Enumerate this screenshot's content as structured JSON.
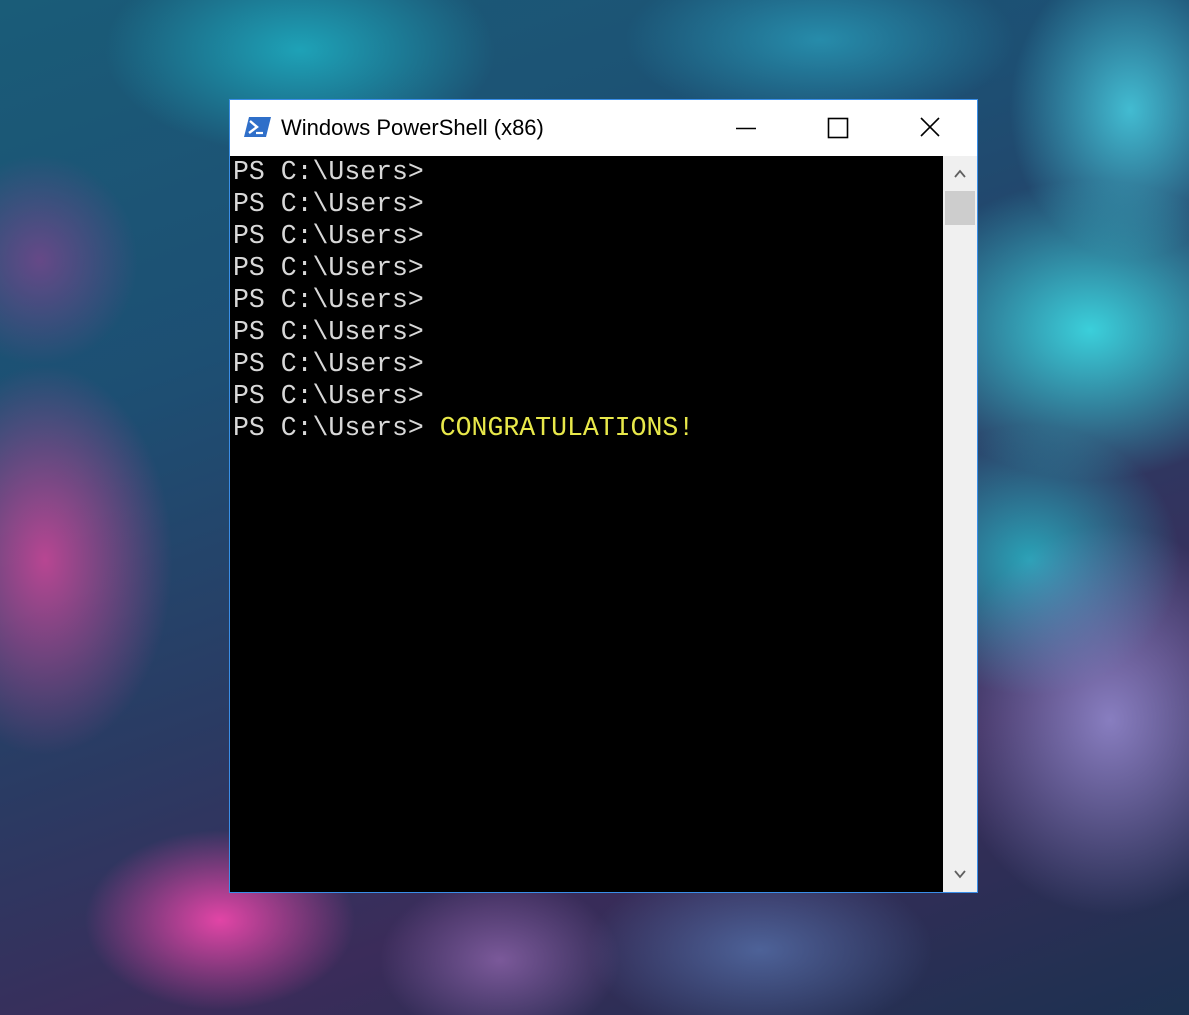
{
  "window": {
    "title": "Windows PowerShell (x86)",
    "app_icon": "powershell-icon",
    "controls": [
      "minimize-icon",
      "maximize-icon",
      "close-icon"
    ]
  },
  "console": {
    "lines": [
      {
        "prompt": "PS C:\\Users>",
        "output": ""
      },
      {
        "prompt": "PS C:\\Users>",
        "output": ""
      },
      {
        "prompt": "PS C:\\Users>",
        "output": ""
      },
      {
        "prompt": "PS C:\\Users>",
        "output": ""
      },
      {
        "prompt": "PS C:\\Users>",
        "output": ""
      },
      {
        "prompt": "PS C:\\Users>",
        "output": ""
      },
      {
        "prompt": "PS C:\\Users>",
        "output": ""
      },
      {
        "prompt": "PS C:\\Users>",
        "output": ""
      },
      {
        "prompt": "PS C:\\Users>",
        "output": " CONGRATULATIONS!"
      }
    ]
  },
  "scrollbar": {
    "up_icon": "chevron-up-icon",
    "down_icon": "chevron-down-icon"
  },
  "colors": {
    "accent_border": "#3a8ee8",
    "console_background": "#000000",
    "console_text": "#d8d8d8",
    "highlight_text": "#e8e84a",
    "icon_blue": "#2f6fc9"
  }
}
